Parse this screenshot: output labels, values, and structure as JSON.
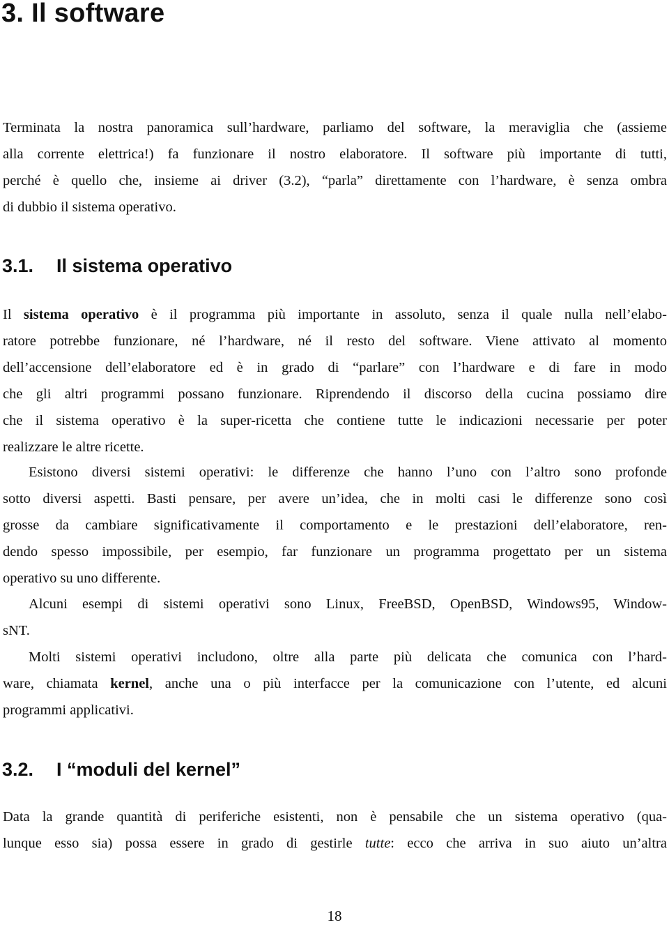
{
  "chapter": {
    "title": "3. Il software"
  },
  "intro": {
    "lines": [
      "Terminata la nostra panoramica sull’hardware, parliamo del software, la meraviglia che (assieme",
      "alla corrente elettrica!)  fa funzionare il nostro elaboratore.  Il software più importante di tutti,",
      "perché è quello che, insieme ai driver (3.2), “parla” direttamente con l’hardware, è senza ombra",
      "di dubbio il sistema operativo."
    ]
  },
  "section_1": {
    "number": "3.1.",
    "title": "Il sistema operativo",
    "p1": {
      "l1_pre": "Il ",
      "l1_bold": "sistema operativo",
      "l1_post": " è il programma più importante in assoluto, senza il quale nulla nell’elabo-",
      "lines": [
        "ratore potrebbe funzionare, né l’hardware, né il resto del software.  Viene attivato al momento",
        "dell’accensione dell’elaboratore ed è in grado di “parlare” con l’hardware e di fare in modo",
        "che gli altri programmi possano funzionare. Riprendendo il discorso della cucina possiamo dire",
        "che il sistema operativo è la super-ricetta che contiene tutte le indicazioni necessarie per poter",
        "realizzare le altre ricette."
      ]
    },
    "p2": {
      "lines": [
        "Esistono diversi sistemi operativi:  le differenze che hanno l’uno con l’altro sono profonde",
        "sotto diversi aspetti.  Basti pensare, per avere un’idea, che in molti casi le differenze sono così",
        "grosse da cambiare significativamente il comportamento e le prestazioni dell’elaboratore, ren-",
        "dendo spesso impossibile, per esempio, far funzionare un programma progettato per un sistema",
        "operativo su uno differente."
      ]
    },
    "p3": {
      "lines": [
        "Alcuni esempi di sistemi operativi sono Linux, FreeBSD, OpenBSD, Windows95, Window-",
        "sNT."
      ]
    },
    "p4": {
      "l1": "Molti sistemi operativi includono, oltre alla parte più delicata che comunica con l’hard-",
      "l2_pre": "ware, chiamata ",
      "l2_bold": "kernel",
      "l2_post": ", anche una o più interfacce per la comunicazione con l’utente, ed alcuni",
      "l3": "programmi applicativi."
    }
  },
  "section_2": {
    "number": "3.2.",
    "title": "I “moduli del kernel”",
    "p1": {
      "l1": "Data la grande quantità di periferiche esistenti, non è pensabile che un sistema operativo (qua-",
      "l2_pre": "lunque esso sia) possa essere in grado di gestirle ",
      "l2_italic": "tutte",
      "l2_post": ":  ecco che arriva in suo aiuto un’altra"
    }
  },
  "footer": {
    "page_number": "18"
  }
}
